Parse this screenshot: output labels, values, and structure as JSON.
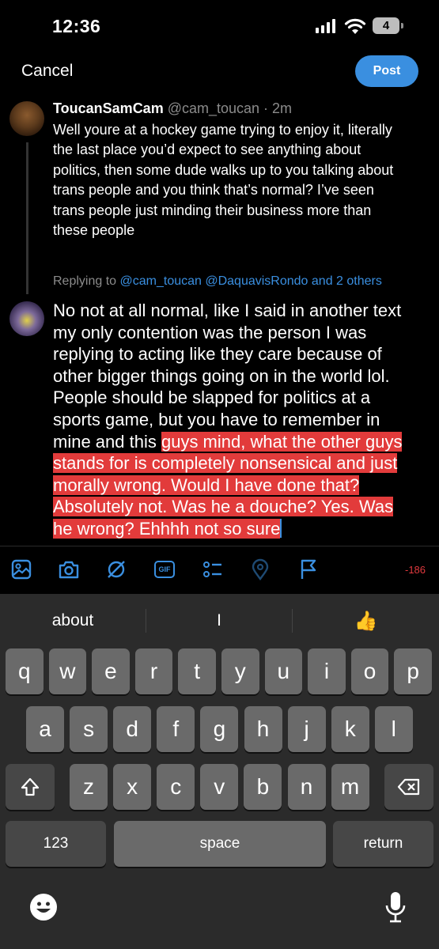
{
  "status_bar": {
    "time": "12:36",
    "battery": "4"
  },
  "header": {
    "cancel_label": "Cancel",
    "post_label": "Post"
  },
  "original_tweet": {
    "display_name": "ToucanSamCam",
    "meta": " @cam_toucan · 2m",
    "lines": [
      "Well youre at a hockey game trying to enjoy it, literally",
      "the last place you’d expect to see anything about",
      "politics, then some dude walks up to you talking about",
      "trans people and you think that’s normal? I’ve seen",
      "trans people just minding their business more than",
      "these people"
    ]
  },
  "replying_to": {
    "prefix": "Replying to ",
    "targets": "@cam_toucan @DaquavisRondo and 2 others"
  },
  "reply": {
    "plain_lines": [
      "No not at all normal, like I said in another text",
      "my only contention was the person I was",
      "replying to acting like they care because of",
      "other bigger things going on in the world lol.",
      "People should be slapped for politics at a",
      "sports game, but you have to remember in"
    ],
    "mixed_plain": "mine and this ",
    "mixed_highlight": "guys mind, what the other guys",
    "highlight_lines": [
      "stands for is completely nonsensical and just",
      "morally wrong. Would I have done that?",
      "Absolutely not. Was he a douche? Yes. Was",
      "he wrong? Ehhhh not so sure"
    ]
  },
  "toolbar": {
    "icons": [
      "image-icon",
      "camera-icon",
      "no-filter-icon",
      "gif-icon",
      "poll-icon",
      "location-icon",
      "flag-icon"
    ],
    "gif_label": "GIF",
    "char_count": "-186"
  },
  "keyboard": {
    "suggestions": [
      "about",
      "I",
      "👍"
    ],
    "row1": [
      "q",
      "w",
      "e",
      "r",
      "t",
      "y",
      "u",
      "i",
      "o",
      "p"
    ],
    "row2": [
      "a",
      "s",
      "d",
      "f",
      "g",
      "h",
      "j",
      "k",
      "l"
    ],
    "row3": [
      "z",
      "x",
      "c",
      "v",
      "b",
      "n",
      "m"
    ],
    "numbers_label": "123",
    "space_label": "space",
    "return_label": "return"
  },
  "colors": {
    "accent": "#3a8fe0",
    "highlight": "#e23b3b",
    "warning": "#e0393e"
  }
}
